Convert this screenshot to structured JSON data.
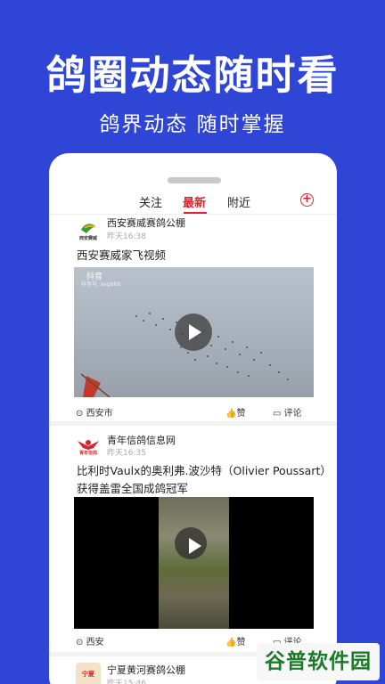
{
  "hero": {
    "title": "鸽圈动态随时看",
    "subtitle": "鸽界动态 随时掌握"
  },
  "tabs": {
    "follow": "关注",
    "latest": "最新",
    "nearby": "附近",
    "add": "+"
  },
  "posts": [
    {
      "author": "西安赛威赛鸽公棚",
      "avatar_text": "西安赛威",
      "time": "昨天16:38",
      "title": "西安赛威家飞视频",
      "video_source_label": "抖音",
      "video_id_label": "抖音号: seg888",
      "location": "西安市",
      "like_label": "赞",
      "comment_label": "评论"
    },
    {
      "author": "青年信鸽信息网",
      "avatar_text": "青年信鸽",
      "time": "昨天16:35",
      "title": "比利时Vaulx的奥利弗.波沙特（Olivier Poussart）获得盖雷全国成鸽冠军",
      "location": "西安",
      "like_label": "赞",
      "comment_label": "评论"
    },
    {
      "author": "宁夏黄河赛鸽公棚",
      "avatar_text": "宁夏",
      "time": "昨天15:46"
    }
  ],
  "watermark": "谷普软件园",
  "colors": {
    "background": "#2f45d6",
    "accent": "#d9262c"
  }
}
